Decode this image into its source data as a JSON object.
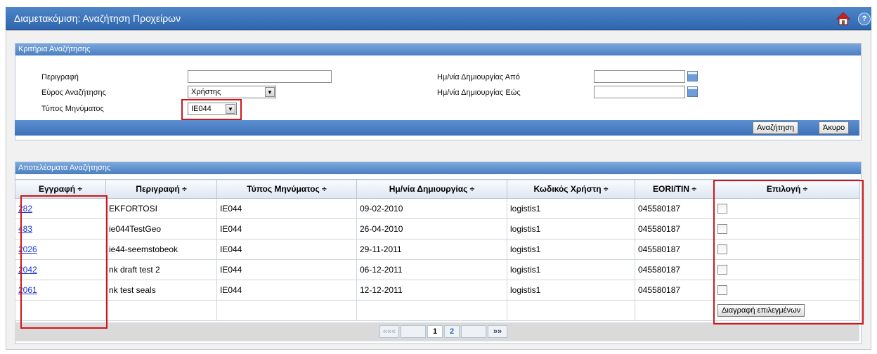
{
  "window": {
    "title": "Διαμετακόμιση: Αναζήτηση Προχείρων"
  },
  "criteria": {
    "header": "Κριτήρια Αναζήτησης",
    "description_label": "Περιγραφή",
    "description_value": "",
    "scope_label": "Εύρος Αναζήτησης",
    "scope_value": "Χρήστης",
    "msgtype_label": "Τύπος Μηνύματος",
    "msgtype_value": "IE044",
    "date_from_label": "Ημ/νία Δημιουργίας Από",
    "date_from_value": "",
    "date_to_label": "Ημ/νία Δημιουργίας Εώς",
    "date_to_value": "",
    "search_button": "Αναζήτηση",
    "cancel_button": "Άκυρο"
  },
  "results": {
    "header": "Αποτελέσματα Αναζήτησης",
    "columns": [
      "Εγγραφή ÷",
      "Περιγραφή ÷",
      "Τύπος Μηνύματος ÷",
      "Ημ/νία Δημιουργίας ÷",
      "Κωδικός Χρήστη ÷",
      "EORI/TIN ÷",
      "Επιλογή ÷"
    ],
    "rows": [
      {
        "id": "282",
        "description": "EKFORTOSI",
        "type": "IE044",
        "date": "09-02-2010",
        "user": "logistis1",
        "eori": "045580187"
      },
      {
        "id": "483",
        "description": "ie044TestGeo",
        "type": "IE044",
        "date": "26-04-2010",
        "user": "logistis1",
        "eori": "045580187"
      },
      {
        "id": "2026",
        "description": "ie44-seemstobeok",
        "type": "IE044",
        "date": "29-11-2011",
        "user": "logistis1",
        "eori": "045580187"
      },
      {
        "id": "2042",
        "description": "nk draft test 2",
        "type": "IE044",
        "date": "06-12-2011",
        "user": "logistis1",
        "eori": "045580187"
      },
      {
        "id": "2061",
        "description": "nk test seals",
        "type": "IE044",
        "date": "12-12-2011",
        "user": "logistis1",
        "eori": "045580187"
      }
    ],
    "delete_selected": "Διαγραφή επιλεγμένων"
  },
  "pager": {
    "first": "«««",
    "page1": "1",
    "page2": "2",
    "last": "»»"
  }
}
